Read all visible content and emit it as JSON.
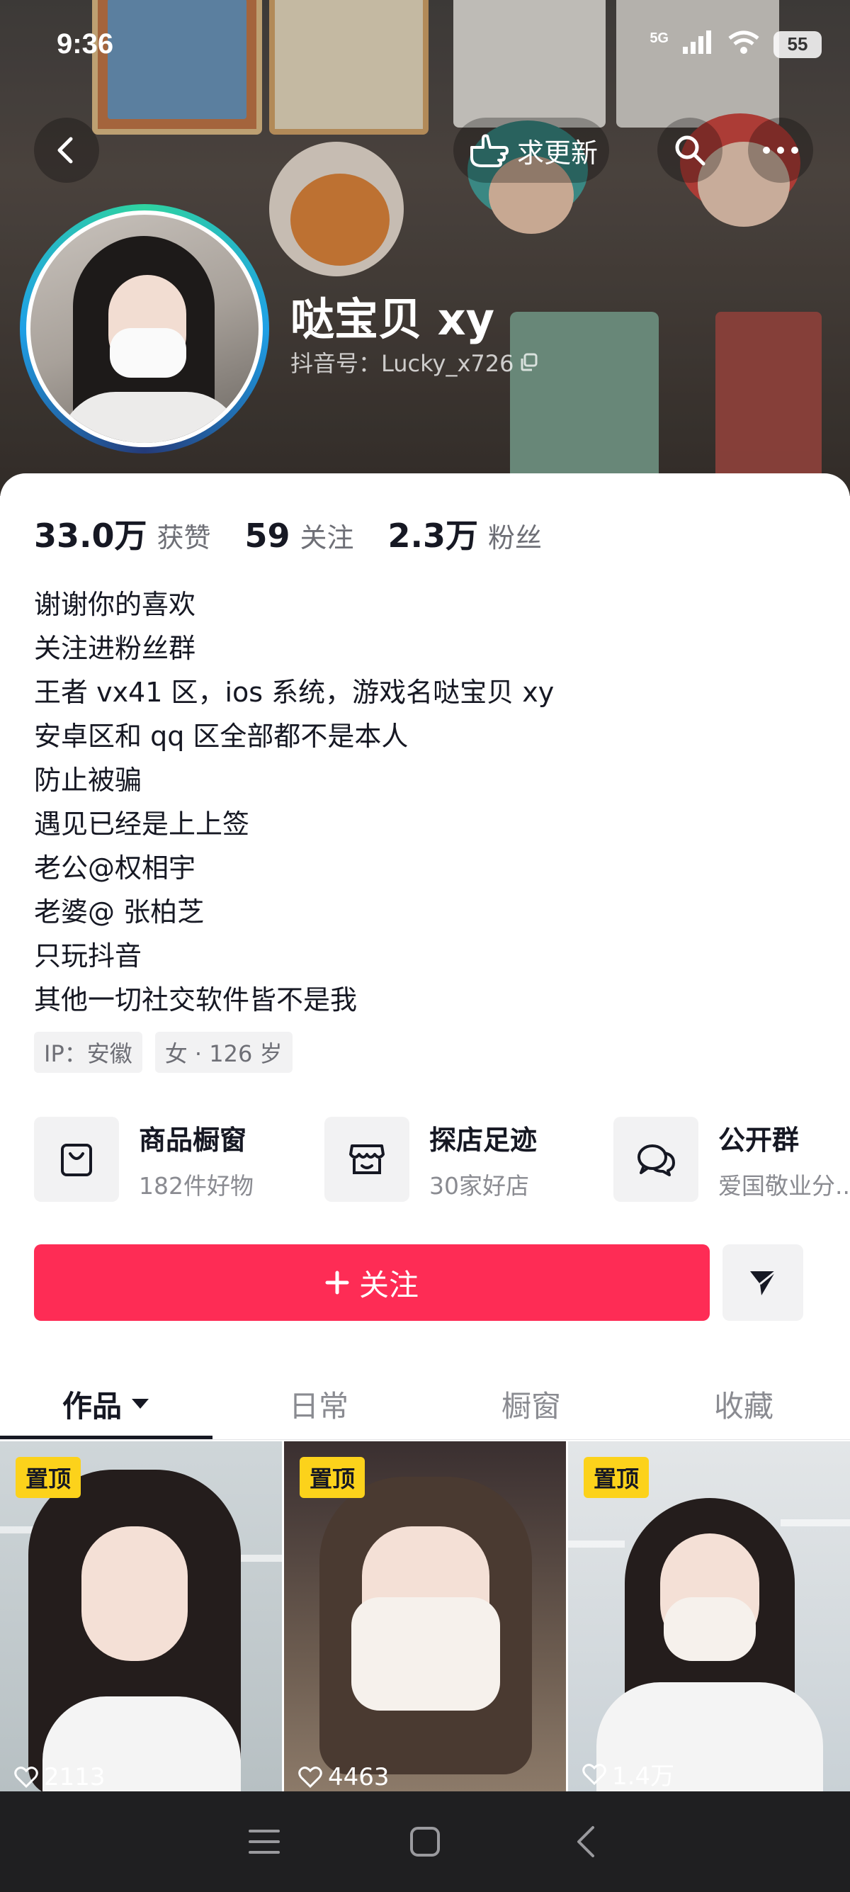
{
  "status_bar": {
    "time": "9:36",
    "network": "5G",
    "battery": "55"
  },
  "nav": {
    "update_label": "求更新"
  },
  "profile": {
    "name": "哒宝贝 xy",
    "handle": "抖音号：Lucky_x726"
  },
  "stats": [
    {
      "value": "33.0万",
      "label": "获赞"
    },
    {
      "value": "59",
      "label": "关注"
    },
    {
      "value": "2.3万",
      "label": "粉丝"
    }
  ],
  "bio": [
    "谢谢你的喜欢",
    "关注进粉丝群",
    "王者 vx41 区，ios 系统，游戏名哒宝贝 xy",
    "安卓区和 qq 区全部都不是本人",
    "防止被骗",
    "遇见已经是上上签",
    "老公@权相宇",
    "老婆@ 张柏芝",
    "只玩抖音",
    "其他一切社交软件皆不是我"
  ],
  "tags": {
    "ip": "IP：安徽",
    "gender_age": "女 · 126 岁"
  },
  "features": [
    {
      "title": "商品橱窗",
      "sub": "182件好物",
      "icon": "shopping-bag-icon"
    },
    {
      "title": "探店足迹",
      "sub": "30家好店",
      "icon": "store-icon"
    },
    {
      "title": "公开群",
      "sub": "爱国敬业分...",
      "icon": "chat-group-icon"
    }
  ],
  "follow_label": "关注",
  "tabs": [
    {
      "label": "作品"
    },
    {
      "label": "日常"
    },
    {
      "label": "橱窗"
    },
    {
      "label": "收藏"
    }
  ],
  "videos": [
    {
      "badge": "置顶",
      "likes": "2113"
    },
    {
      "badge": "置顶",
      "likes": "4463"
    },
    {
      "badge": "置顶",
      "likes": "1.4万"
    }
  ],
  "colors": {
    "accent": "#fe2c55",
    "pin_badge": "#fcd21b",
    "text": "#161823",
    "muted": "#8a8b91"
  }
}
